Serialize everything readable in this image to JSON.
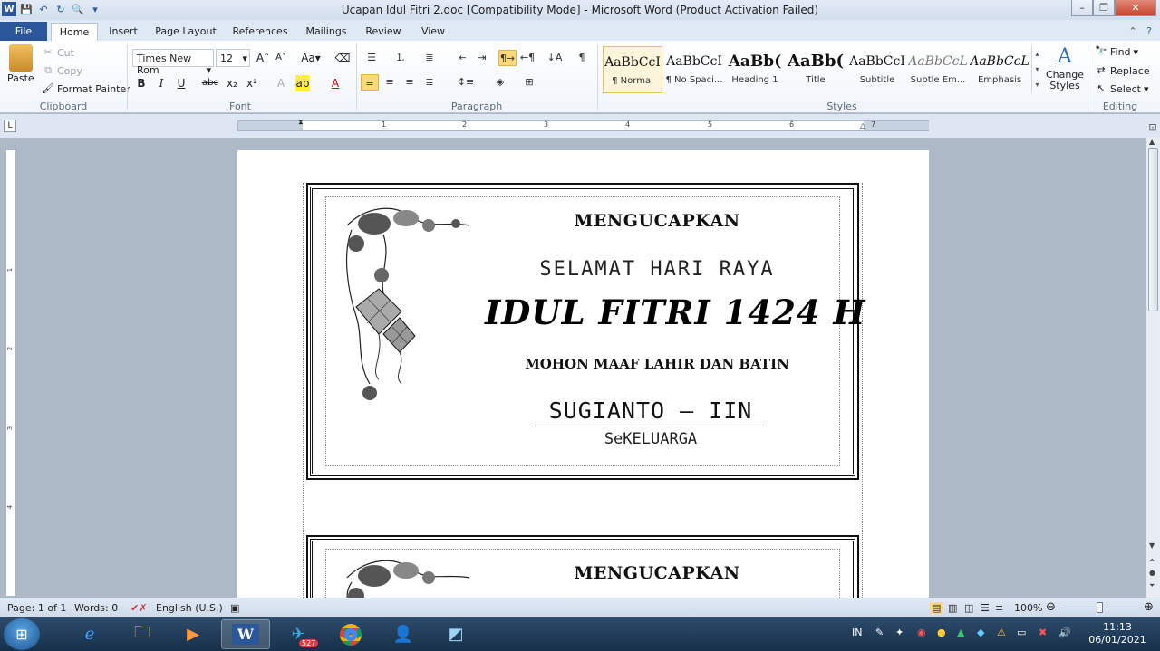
{
  "window": {
    "title": "Ucapan Idul Fitri 2.doc [Compatibility Mode] - Microsoft Word (Product Activation Failed)",
    "minimize": "–",
    "restore": "❐",
    "close": "✕"
  },
  "tabs": [
    "File",
    "Home",
    "Insert",
    "Page Layout",
    "References",
    "Mailings",
    "Review",
    "View"
  ],
  "clipboard": {
    "paste": "Paste",
    "cut": "Cut",
    "copy": "Copy",
    "format_painter": "Format Painter",
    "label": "Clipboard"
  },
  "font": {
    "name": "Times New Rom",
    "size": "12",
    "label": "Font"
  },
  "paragraph": {
    "label": "Paragraph"
  },
  "styles": {
    "label": "Styles",
    "items": [
      {
        "sample": "AaBbCcI",
        "name": "¶ Normal"
      },
      {
        "sample": "AaBbCcI",
        "name": "¶ No Spaci..."
      },
      {
        "sample": "AaBb(",
        "name": "Heading 1"
      },
      {
        "sample": "AaBb(",
        "name": "Title"
      },
      {
        "sample": "AaBbCcI",
        "name": "Subtitle"
      },
      {
        "sample": "AaBbCcL",
        "name": "Subtle Em..."
      },
      {
        "sample": "AaBbCcL",
        "name": "Emphasis"
      }
    ],
    "change_styles": "Change Styles"
  },
  "editing": {
    "find": "Find",
    "replace": "Replace",
    "select": "Select",
    "label": "Editing"
  },
  "ruler": {
    "numbers": [
      "1",
      "2",
      "3",
      "4",
      "5",
      "6",
      "7"
    ]
  },
  "vruler": {
    "numbers": [
      "1",
      "2",
      "3",
      "4"
    ]
  },
  "document": {
    "card1": {
      "line1": "MENGUCAPKAN",
      "line2": "SELAMAT HARI RAYA",
      "line3": "IDUL FITRI 1424 H",
      "line4": "MOHON MAAF LAHIR DAN BATIN",
      "line5": "SUGIANTO – IIN",
      "line6": "SeKELUARGA"
    },
    "card2": {
      "line1": "MENGUCAPKAN"
    }
  },
  "status": {
    "page": "Page: 1 of 1",
    "words": "Words: 0",
    "language": "English (U.S.)",
    "zoom": "100%"
  },
  "taskbar": {
    "telegram_badge": "527",
    "lang": "IN",
    "time": "11:13",
    "date": "06/01/2021"
  }
}
